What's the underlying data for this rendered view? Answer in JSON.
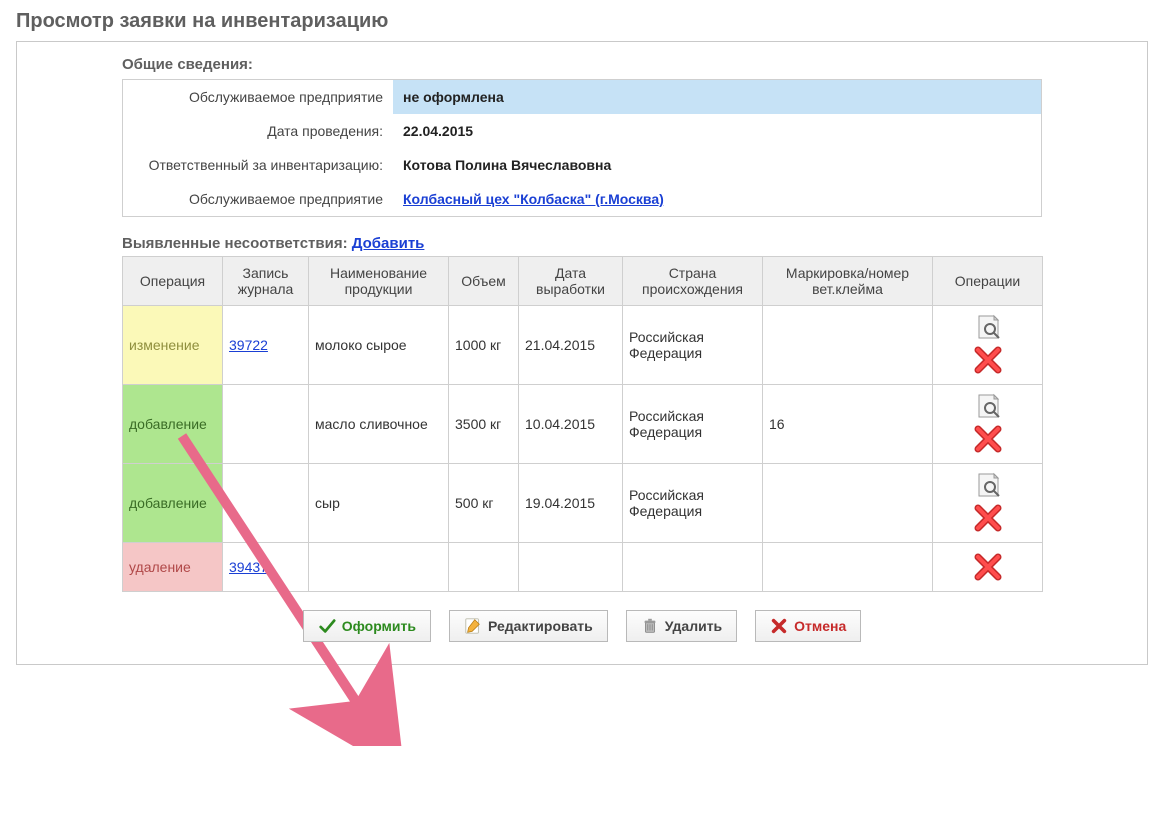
{
  "page_title": "Просмотр заявки на инвентаризацию",
  "general": {
    "section_title": "Общие сведения:",
    "rows": [
      {
        "label": "Обслуживаемое предприятие",
        "value": "не оформлена",
        "highlight": true
      },
      {
        "label": "Дата проведения:",
        "value": "22.04.2015"
      },
      {
        "label": "Ответственный за инвентаризацию:",
        "value": "Котова Полина Вячеславовна"
      },
      {
        "label": "Обслуживаемое предприятие",
        "value": "Колбасный цех \"Колбаска\" (г.Москва)",
        "link": true
      }
    ]
  },
  "discrepancies": {
    "title": "Выявленные несоответствия:",
    "add_label": "Добавить",
    "headers": [
      "Операция",
      "Запись журнала",
      "Наименование продукции",
      "Объем",
      "Дата выработки",
      "Страна происхождения",
      "Маркировка/номер вет.клейма",
      "Операции"
    ],
    "rows": [
      {
        "op": "изменение",
        "op_kind": "change",
        "journal": "39722",
        "journal_link": true,
        "product": "молоко сырое",
        "volume": "1000 кг",
        "date": "21.04.2015",
        "country": "Российская Федерация",
        "mark": "",
        "show_view": true
      },
      {
        "op": "добавление",
        "op_kind": "add",
        "journal": "",
        "product": "масло сливочное",
        "volume": "3500 кг",
        "date": "10.04.2015",
        "country": "Российская Федерация",
        "mark": "16",
        "show_view": true
      },
      {
        "op": "добавление",
        "op_kind": "add",
        "journal": "",
        "product": "сыр",
        "volume": "500 кг",
        "date": "19.04.2015",
        "country": "Российская Федерация",
        "mark": "",
        "show_view": true
      },
      {
        "op": "удаление",
        "op_kind": "delete",
        "journal": "39437",
        "journal_link": true,
        "product": "",
        "volume": "",
        "date": "",
        "country": "",
        "mark": "",
        "show_view": false
      }
    ]
  },
  "toolbar": {
    "submit": "Оформить",
    "edit": "Редактировать",
    "delete": "Удалить",
    "cancel": "Отмена"
  },
  "icons": {
    "view": "view-icon",
    "delete_row": "delete-icon",
    "check": "check-icon",
    "pencil": "pencil-icon",
    "trash": "trash-icon",
    "cross": "cross-icon"
  }
}
